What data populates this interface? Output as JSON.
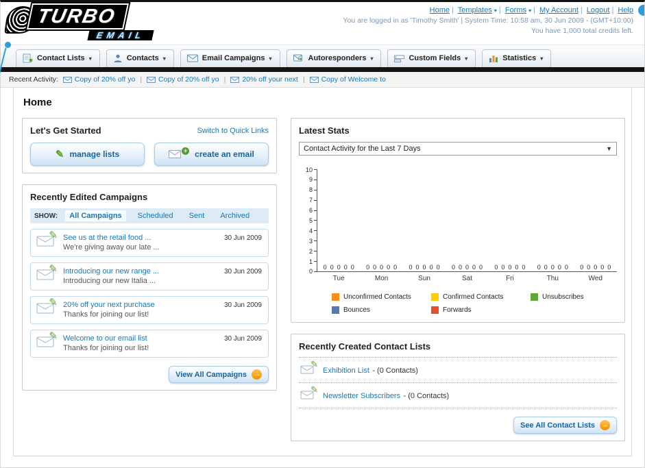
{
  "header": {
    "logo_line1": "TURBO",
    "logo_line2": "EMAIL",
    "nav_links": [
      "Home",
      "Templates",
      "Forms",
      "My Account",
      "Logout",
      "Help"
    ],
    "login_text": "You are logged in as 'Timothy Smith' | System Time: 10:58 am, 30 Jun 2009 - (GMT+10:00)",
    "credits_text": "You have 1,000 total credits left."
  },
  "main_nav": {
    "items": [
      "Contact Lists",
      "Contacts",
      "Email Campaigns",
      "Autoresponders",
      "Custom Fields",
      "Statistics"
    ]
  },
  "recent_activity": {
    "label": "Recent Activity:",
    "items": [
      "Copy of 20% off yo",
      "Copy of 20% off yo",
      "20% off your next",
      "Copy of Welcome to"
    ]
  },
  "page": {
    "title": "Home"
  },
  "get_started": {
    "title": "Let's Get Started",
    "switch_link": "Switch to Quick Links",
    "manage_lists_label": "manage lists",
    "create_email_label": "create an email"
  },
  "campaigns": {
    "title": "Recently Edited Campaigns",
    "show_label": "SHOW:",
    "tabs": [
      "All Campaigns",
      "Scheduled",
      "Sent",
      "Archived"
    ],
    "active_tab": "All Campaigns",
    "items": [
      {
        "title": "See us at the retail food ...",
        "subtitle": "We're giving away our late ...",
        "date": "30 Jun 2009"
      },
      {
        "title": "Introducing our new range ...",
        "subtitle": "Introducing our new Italia ...",
        "date": "30 Jun 2009"
      },
      {
        "title": "20% off your next purchase",
        "subtitle": "Thanks for joining our list!",
        "date": "30 Jun 2009"
      },
      {
        "title": "Welcome to our email list",
        "subtitle": "Thanks for joining our list!",
        "date": "30 Jun 2009"
      }
    ],
    "view_all_label": "View All Campaigns"
  },
  "stats": {
    "title": "Latest Stats",
    "period_selected": "Contact Activity for the Last 7 Days",
    "chart_data": {
      "type": "bar",
      "title": "Contact Activity for the Last 7 Days",
      "categories": [
        "Tue",
        "Mon",
        "Sun",
        "Sat",
        "Fri",
        "Thu",
        "Wed"
      ],
      "series": [
        {
          "name": "Unconfirmed Contacts",
          "values": [
            0,
            0,
            0,
            0,
            0,
            0,
            0
          ]
        },
        {
          "name": "Confirmed Contacts",
          "values": [
            0,
            0,
            0,
            0,
            0,
            0,
            0
          ]
        },
        {
          "name": "Unsubscribes",
          "values": [
            0,
            0,
            0,
            0,
            0,
            0,
            0
          ]
        },
        {
          "name": "Bounces",
          "values": [
            0,
            0,
            0,
            0,
            0,
            0,
            0
          ]
        },
        {
          "name": "Forwards",
          "values": [
            0,
            0,
            0,
            0,
            0,
            0,
            0
          ]
        }
      ],
      "ylim": [
        0,
        10
      ],
      "ytick_step": 1,
      "grid": false,
      "legend_position": "bottom",
      "value_labels_shown": true
    },
    "legend": [
      {
        "label": "Unconfirmed Contacts",
        "color": "#f78f1e"
      },
      {
        "label": "Confirmed Contacts",
        "color": "#ffcc00"
      },
      {
        "label": "Unsubscribes",
        "color": "#64a53a"
      },
      {
        "label": "Bounces",
        "color": "#5a78aa"
      },
      {
        "label": "Forwards",
        "color": "#e8502a"
      }
    ]
  },
  "contact_lists": {
    "title": "Recently Created Contact Lists",
    "items": [
      {
        "name": "Exhibition List",
        "detail": "- (0 Contacts)"
      },
      {
        "name": "Newsletter Subscribers",
        "detail": "- (0 Contacts)"
      }
    ],
    "see_all_label": "See All Contact Lists"
  },
  "colors": {
    "link_blue": "#1779b5",
    "accent_orange": "#ef9200",
    "nav_strip": "#141414"
  }
}
